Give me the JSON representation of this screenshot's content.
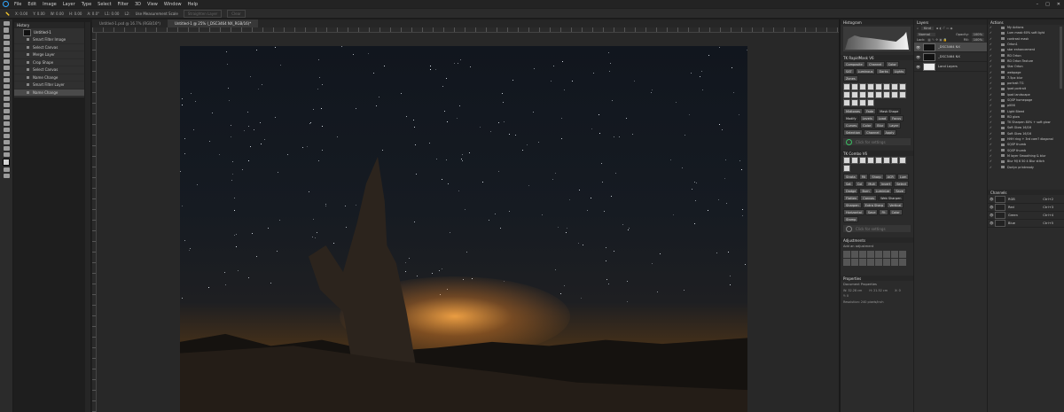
{
  "menubar": {
    "items": [
      "File",
      "Edit",
      "Image",
      "Layer",
      "Type",
      "Select",
      "Filter",
      "3D",
      "View",
      "Window",
      "Help"
    ],
    "window_controls": [
      "–",
      "□",
      "✕"
    ]
  },
  "optionsbar": {
    "fields": [
      "X: 0.00",
      "Y: 0.00",
      "W: 0.00",
      "H: 0.00",
      "A: 0.0°",
      "L1: 0.00",
      "L2:"
    ],
    "use_measurement_scale": "Use Measurement Scale",
    "straighten_layer": "Straighten Layer",
    "clear": "Clear"
  },
  "history": {
    "title": "History",
    "snapshot": "Untitled-1",
    "items": [
      "Smart Filter Image",
      "Select Canvas",
      "Merge Layer",
      "Crop Shape",
      "Select Canvas",
      "Name Change",
      "Smart Filter Layer",
      "Name Change"
    ]
  },
  "document": {
    "tabs": [
      "Untitled-1.psd @ 16.7% (RGB/16*)",
      "Untitled-1 @ 25% (_DSC3464 NX_RGB/16)*"
    ]
  },
  "histogram": {
    "title": "Histogram"
  },
  "tk_rapidmask": {
    "title": "TK RapidMask V6",
    "buttons": [
      "Composite",
      "Channel",
      "Color",
      "SAT",
      "Luminous",
      "Darks",
      "Lights",
      "Zones",
      "Midtones",
      "Fade",
      "Mask Shape",
      "Modify",
      "Levels",
      "Load",
      "Focus",
      "Curves",
      "Color",
      "Blur",
      "Layer",
      "Selection",
      "Channel",
      "Apply"
    ],
    "click_settings": "Click for settings"
  },
  "tk_combo": {
    "title": "TK Combo V6",
    "buttons": [
      "Strata",
      "Fill",
      "Sharp",
      "ACR",
      "Lum",
      "Sat",
      "Col",
      "Mult",
      "Invert",
      "Select",
      "Dodge",
      "Burn",
      "Luminize",
      "Save",
      "Flatten",
      "Canvas",
      "Web Sharpen",
      "Sharpen",
      "Extra Sharp",
      "Vertical",
      "Horizontal",
      "Save",
      "Fit",
      "Color",
      "Stamp"
    ],
    "click_settings": "Click for settings"
  },
  "adjustments": {
    "title": "Adjustments",
    "subtitle": "Add an adjustment"
  },
  "properties": {
    "title": "Properties",
    "subtitle": "Document Properties",
    "fields": [
      "W: 32.28 cm",
      "H: 21.52 cm",
      "X: 0",
      "Y: 0"
    ],
    "resolution": "Resolution: 240 pixels/inch"
  },
  "layers": {
    "title": "Layers",
    "filter": "Kind",
    "blend_mode": "Normal",
    "opacity_label": "Opacity:",
    "opacity": "100%",
    "fill_label": "Fill:",
    "fill": "100%",
    "lock_label": "Lock:",
    "rows": [
      {
        "name": "_DSC3464 NX",
        "selected": true,
        "thumb": "dark"
      },
      {
        "name": "_DSC3464 NX",
        "selected": false,
        "thumb": "dark"
      },
      {
        "name": "Land Layers",
        "selected": false,
        "thumb": "white"
      }
    ]
  },
  "actions": {
    "title": "Actions",
    "items": [
      "My Actions",
      "Lum mask 60% soft light",
      "contrast mask",
      "Orton1",
      "star enhancement",
      "RD Orton",
      "RD Orton Texture",
      "Star Orton",
      "webpage",
      "7.5px blur",
      "portrait TG",
      "ipad portrait",
      "ipad landscape",
      "SQSP homepage",
      "plt56",
      "Light Bleed",
      "RD glow",
      "TK Sharpen 80% + soft glow",
      "Soft Glow 16/16",
      "Soft Glow 16/16",
      "HHH ring + 3rd cam? diagonal",
      "SQSP thumb",
      "SQSP thumb",
      "M layer Smoothing & blur",
      "Blur MJ 6 50 4 Blur stitch",
      "Dorlyn printready"
    ]
  },
  "channels": {
    "title": "Channels",
    "rows": [
      {
        "name": "RGB",
        "shortcut": "Ctrl+2"
      },
      {
        "name": "Red",
        "shortcut": "Ctrl+3"
      },
      {
        "name": "Green",
        "shortcut": "Ctrl+4"
      },
      {
        "name": "Blue",
        "shortcut": "Ctrl+5"
      }
    ]
  },
  "colors": {
    "accent": "#31a8ff",
    "panel": "#2b2b2b",
    "selected": "#4a4a4a",
    "click_settings_ring": "#3bbf63"
  }
}
